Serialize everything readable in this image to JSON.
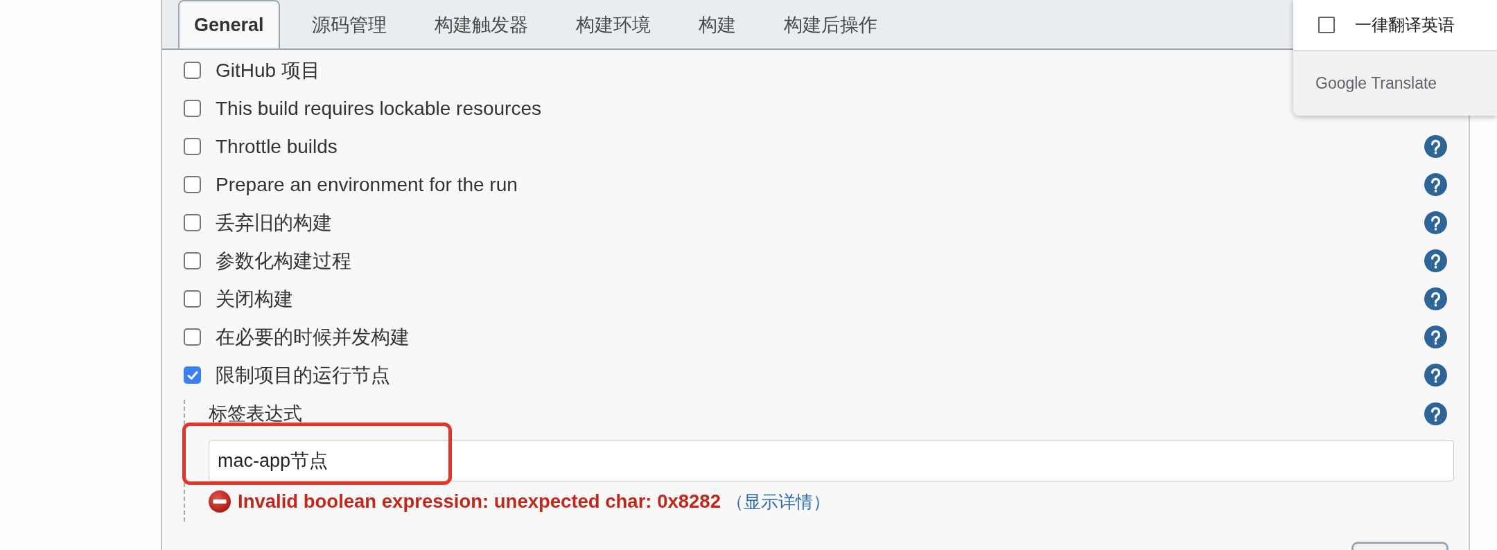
{
  "tabs": [
    {
      "label": "General",
      "selected": true
    },
    {
      "label": "源码管理",
      "selected": false
    },
    {
      "label": "构建触发器",
      "selected": false
    },
    {
      "label": "构建环境",
      "selected": false
    },
    {
      "label": "构建",
      "selected": false
    },
    {
      "label": "构建后操作",
      "selected": false
    }
  ],
  "options": [
    {
      "label": "GitHub 项目",
      "checked": false,
      "help": false
    },
    {
      "label": "This build requires lockable resources",
      "checked": false,
      "help": false
    },
    {
      "label": "Throttle builds",
      "checked": false,
      "help": true
    },
    {
      "label": "Prepare an environment for the run",
      "checked": false,
      "help": true
    },
    {
      "label": "丢弃旧的构建",
      "checked": false,
      "help": true
    },
    {
      "label": "参数化构建过程",
      "checked": false,
      "help": true
    },
    {
      "label": "关闭构建",
      "checked": false,
      "help": true
    },
    {
      "label": "在必要的时候并发构建",
      "checked": false,
      "help": true
    },
    {
      "label": "限制项目的运行节点",
      "checked": true,
      "help": true,
      "details": {
        "label": "标签表达式",
        "help": true,
        "value": "mac-app节点",
        "highlighted": true,
        "error": {
          "message": "Invalid boolean expression: unexpected char: 0x8282",
          "link": "（显示详情）"
        }
      }
    }
  ],
  "translate_popup": {
    "option": {
      "label": "一律翻译英语",
      "checked": false
    },
    "brand": "Google Translate"
  }
}
